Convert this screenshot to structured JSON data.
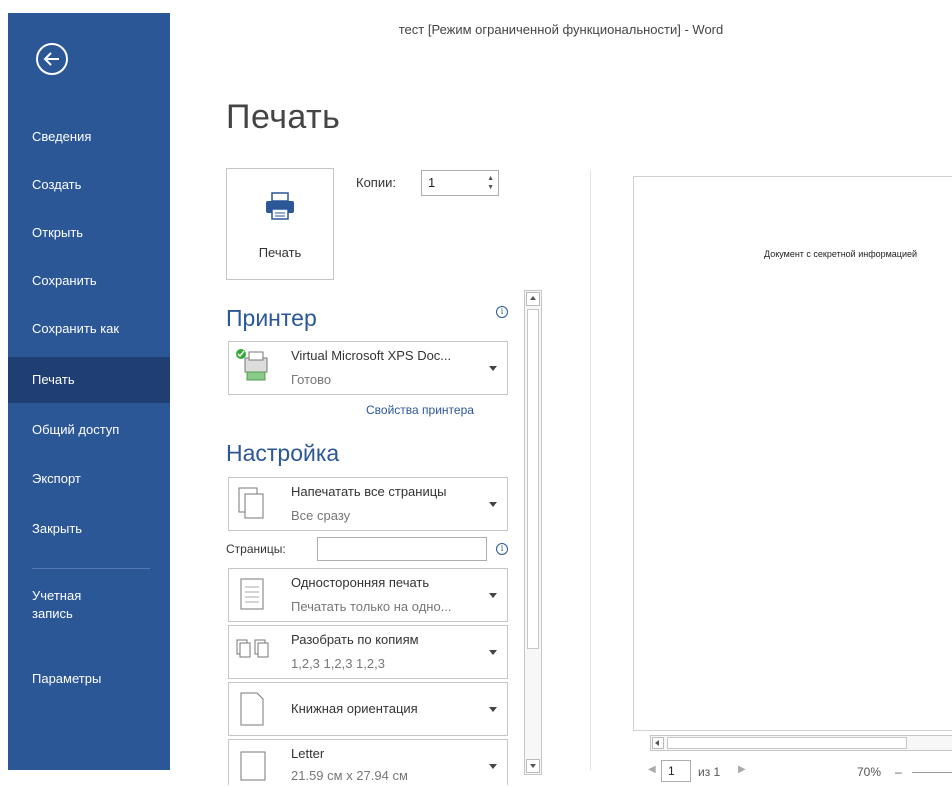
{
  "window": {
    "title": "тест [Режим ограниченной функциональности] - Word"
  },
  "sidebar": {
    "items": [
      {
        "label": "Сведения"
      },
      {
        "label": "Создать"
      },
      {
        "label": "Открыть"
      },
      {
        "label": "Сохранить"
      },
      {
        "label": "Сохранить как"
      },
      {
        "label": "Печать",
        "active": true
      },
      {
        "label": "Общий доступ"
      },
      {
        "label": "Экспорт"
      },
      {
        "label": "Закрыть"
      },
      {
        "label": "Учетная запись"
      },
      {
        "label": "Параметры"
      }
    ]
  },
  "print": {
    "heading": "Печать",
    "button_label": "Печать",
    "copies_label": "Копии:",
    "copies_value": "1"
  },
  "printer": {
    "section_title": "Принтер",
    "name": "Virtual Microsoft XPS Doc...",
    "status": "Готово",
    "properties_link": "Свойства принтера"
  },
  "settings": {
    "section_title": "Настройка",
    "pages_label": "Страницы:",
    "pages_value": "",
    "dropdowns": [
      {
        "line1": "Напечатать все страницы",
        "line2": "Все сразу"
      },
      {
        "line1": "Односторонняя печать",
        "line2": "Печатать только на одно..."
      },
      {
        "line1": "Разобрать по копиям",
        "line2": "1,2,3   1,2,3   1,2,3"
      },
      {
        "line1": "Книжная ориентация",
        "line2": ""
      },
      {
        "line1": "Letter",
        "line2": "21.59 см x 27.94 см"
      }
    ]
  },
  "preview": {
    "doc_text": "Документ с секретной информацией",
    "page_number": "1",
    "page_of": "из 1",
    "zoom": "70%",
    "zoom_minus": "–"
  },
  "colors": {
    "accent": "#2b5797",
    "sidebar_active": "#1f3f73"
  }
}
